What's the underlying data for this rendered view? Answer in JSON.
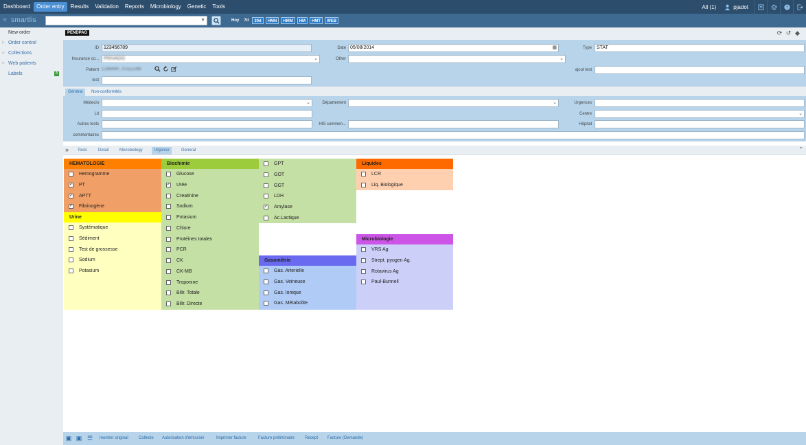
{
  "topbar": {
    "menu": [
      "Dashboard",
      "Order entry",
      "Results",
      "Validation",
      "Reports",
      "Microbiology",
      "Genetic",
      "Tools"
    ],
    "all_count": "All (1)",
    "username": "pjadot"
  },
  "brand": "smartlis",
  "quick_filters": [
    "Hoy",
    "7d",
    "30d",
    "HMN",
    "HMM",
    "HM",
    "HMT",
    "WEB"
  ],
  "sidebar": {
    "items": [
      "New order",
      "Order control",
      "Collections",
      "Web patients",
      "Labels"
    ],
    "labels_badge": "A"
  },
  "status_tag": "PENDPAG",
  "form": {
    "id_label": "ID",
    "id_value": "123456789",
    "date_label": "Date",
    "date_value": "05/08/2014",
    "type_label": "Type",
    "type_value": "STAT",
    "insurance_label": "Insurance co...",
    "insurance_value": "PRIVADO",
    "other_label": "Other",
    "patient_label": "Patient",
    "patient_value": "CJNHHH , STELLHM",
    "ajout_label": "ajout test",
    "test_label": "test"
  },
  "tabs_top": [
    "Général",
    "Non-conformités"
  ],
  "form2": {
    "medecin_label": "Médecin",
    "departement_label": "Département",
    "urgences_label": "Urgences",
    "lit_label": "Lit",
    "centre_label": "Centre",
    "autres_label": "Autres tests",
    "his_label": "HIS commen...",
    "hopital_label": "Hôpital",
    "commentaires_label": "commentaires"
  },
  "tabs_tests": [
    "Tests",
    "Detail",
    "Microbiology",
    "Urgence",
    "General"
  ],
  "panels": {
    "hematologie": {
      "title": "HEMATOLOGIE",
      "items": [
        {
          "label": "Hemogramme",
          "checked": false
        },
        {
          "label": "PT",
          "checked": true
        },
        {
          "label": "APTT",
          "checked": true
        },
        {
          "label": "Fibrinogène",
          "checked": true
        }
      ]
    },
    "urine": {
      "title": "Urine",
      "items": [
        {
          "label": "Systématique",
          "checked": false
        },
        {
          "label": "Sédiment",
          "checked": false
        },
        {
          "label": "Test de grossesse",
          "checked": false
        },
        {
          "label": "Sodium",
          "checked": false
        },
        {
          "label": "Potasium",
          "checked": false
        }
      ]
    },
    "biochimie": {
      "title": "Biochimie",
      "items": [
        {
          "label": "Glucose",
          "checked": false
        },
        {
          "label": "Urée",
          "checked": true
        },
        {
          "label": "Creatinine",
          "checked": false
        },
        {
          "label": "Sodium",
          "checked": false
        },
        {
          "label": "Potasium",
          "checked": false
        },
        {
          "label": "Chlore",
          "checked": false
        },
        {
          "label": "Protéines totales",
          "checked": false
        },
        {
          "label": "PCR",
          "checked": false
        },
        {
          "label": "CK",
          "checked": false
        },
        {
          "label": "CK-MB",
          "checked": false
        },
        {
          "label": "Troponine",
          "checked": false
        },
        {
          "label": "Bilir. Totale",
          "checked": false
        },
        {
          "label": "Bilir. Directe",
          "checked": false
        }
      ]
    },
    "biochimie2": {
      "items": [
        {
          "label": "GPT",
          "checked": false
        },
        {
          "label": "GOT",
          "checked": false
        },
        {
          "label": "GGT",
          "checked": false
        },
        {
          "label": "LDH",
          "checked": false
        },
        {
          "label": "Amylase",
          "checked": true
        },
        {
          "label": "Ac.Lactique",
          "checked": false
        }
      ]
    },
    "gasometrie": {
      "title": "Gasométrie",
      "items": [
        {
          "label": "Gas. Arterielle",
          "checked": false
        },
        {
          "label": "Gas. Veineuse",
          "checked": false
        },
        {
          "label": "Gas. Ionique",
          "checked": false
        },
        {
          "label": "Gas. Métabolite",
          "checked": false
        }
      ]
    },
    "liquides": {
      "title": "Liquides",
      "items": [
        {
          "label": "LCR",
          "checked": false
        },
        {
          "label": "Liq. Biologique",
          "checked": false
        }
      ]
    },
    "microbiologie": {
      "title": "Microbiologie",
      "items": [
        {
          "label": "VRS Ag",
          "checked": false
        },
        {
          "label": "Strept. pyogen Ag.",
          "checked": false
        },
        {
          "label": "Rotavirus Ag",
          "checked": false
        },
        {
          "label": "Paul-Bunnell",
          "checked": false
        }
      ]
    }
  },
  "footer_links": [
    "montrer original",
    "Collecte",
    "Autorisation d'émission",
    "Imprimer facture",
    "Facture préliminaire",
    "Recept",
    "Facture (Demande)"
  ],
  "colors": {
    "hematologie": "#f0a067",
    "hematologie_header": "#ff7f00",
    "urine": "#ffffc0",
    "urine_header": "#ffff00",
    "biochimie": "#c5e0a5",
    "biochimie_header": "#9ccc3c",
    "gasometrie": "#b0cbf5",
    "gasometrie_header": "#6a6af0",
    "liquides": "#ffd0b0",
    "liquides_header": "#ff6a00",
    "microbiologie": "#ccd0f8",
    "microbiologie_header": "#cc55e8"
  }
}
